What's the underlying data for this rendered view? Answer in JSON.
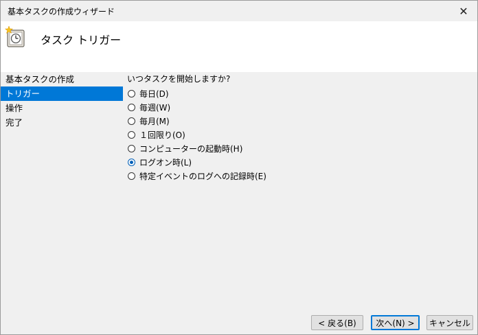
{
  "window": {
    "title": "基本タスクの作成ウィザード",
    "close_glyph": "✕"
  },
  "header": {
    "title": "タスク トリガー",
    "icon": "task-scheduler-icon"
  },
  "nav": {
    "items": [
      {
        "label": "基本タスクの作成",
        "active": false
      },
      {
        "label": "トリガー",
        "active": true
      },
      {
        "label": "操作",
        "active": false
      },
      {
        "label": "完了",
        "active": false
      }
    ]
  },
  "content": {
    "question": "いつタスクを開始しますか?",
    "options": [
      {
        "label": "毎日(D)",
        "checked": false
      },
      {
        "label": "毎週(W)",
        "checked": false
      },
      {
        "label": "毎月(M)",
        "checked": false
      },
      {
        "label": "１回限り(O)",
        "checked": false
      },
      {
        "label": "コンピューターの起動時(H)",
        "checked": false
      },
      {
        "label": "ログオン時(L)",
        "checked": true
      },
      {
        "label": "特定イベントのログへの記録時(E)",
        "checked": false
      }
    ]
  },
  "buttons": {
    "back": "< 戻る(B)",
    "next": "次へ(N) >",
    "cancel": "キャンセル"
  },
  "colors": {
    "accent": "#0078d7",
    "radio_checked": "#005fb8"
  }
}
